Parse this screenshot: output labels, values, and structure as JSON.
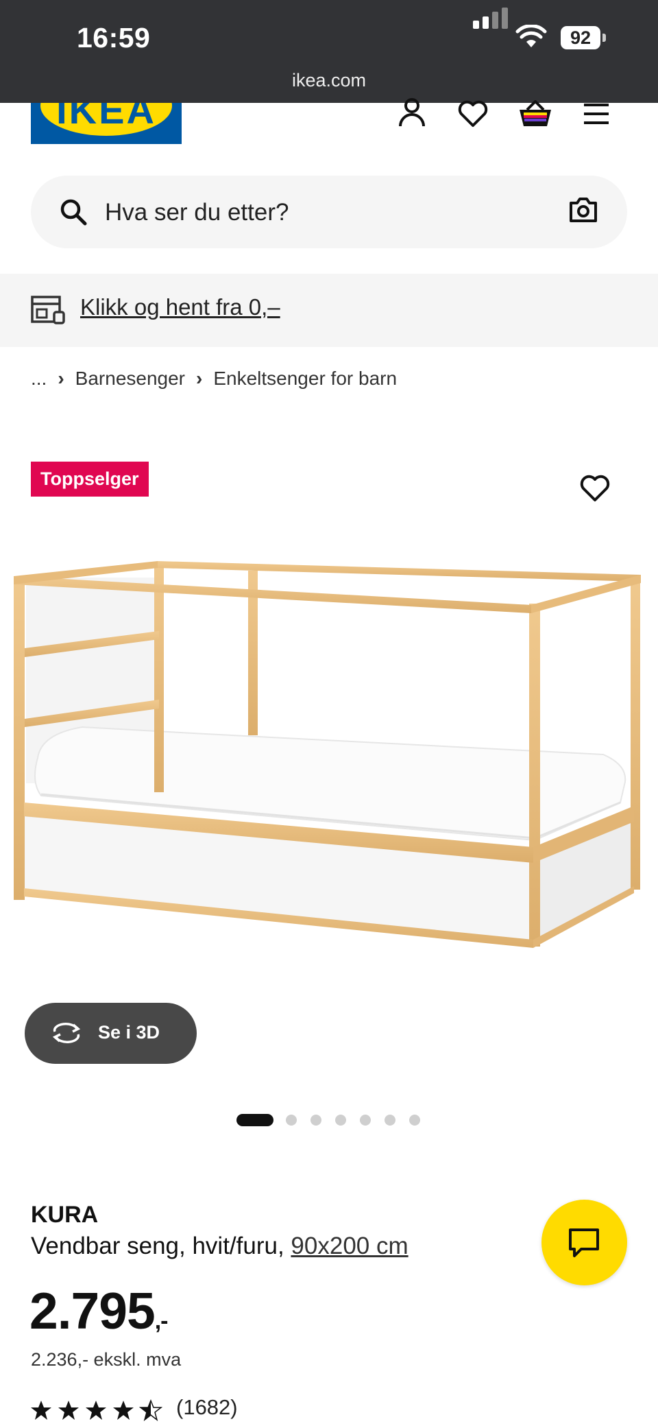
{
  "status_bar": {
    "time": "16:59",
    "battery": "92",
    "url": "ikea.com"
  },
  "header": {
    "logo_text": "IKEA",
    "brand_colors": {
      "blue": "#0058a3",
      "yellow": "#ffdb00"
    },
    "icons": [
      "account-icon",
      "heart-icon",
      "basket-icon",
      "menu-icon"
    ]
  },
  "search": {
    "placeholder": "Hva ser du etter?"
  },
  "banner": {
    "text": "Klikk og hent fra 0,–"
  },
  "breadcrumb": {
    "items": [
      "...",
      "Barnesenger",
      "Enkeltsenger for barn"
    ]
  },
  "product": {
    "badge": "Toppselger",
    "badge_color": "#e00751",
    "view_3d_label": "Se i 3D",
    "gallery": {
      "count": 7,
      "active": 1
    },
    "name": "KURA",
    "description": "Vendbar seng, hvit/furu,",
    "size_link": "90x200 cm",
    "price": "2.795",
    "price_suffix": ",-",
    "price_excl_vat": "2.236,- ekskl. mva",
    "rating": 4.5,
    "review_count": "(1682)"
  }
}
